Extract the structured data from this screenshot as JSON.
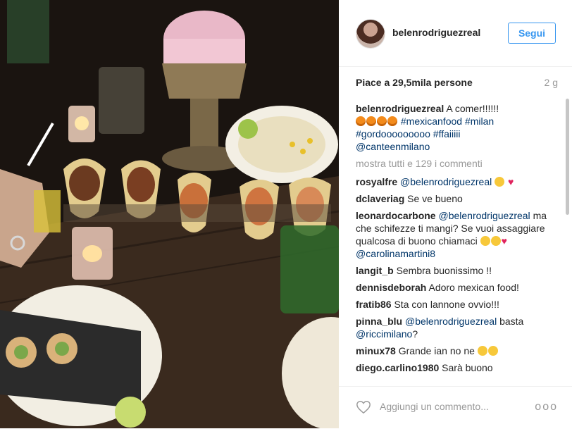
{
  "post": {
    "username": "belenrodriguezreal",
    "follow_label": "Segui",
    "likes": "Piace a 29,5mila persone",
    "time": "2 g"
  },
  "caption": {
    "user": "belenrodriguezreal",
    "text": "A comer!!!!!!",
    "hashtags": [
      "#mexicanfood",
      "#milan",
      "#gordooooooooo",
      "#ffaiiiii"
    ],
    "mention": "@canteenmilano"
  },
  "more_comments": "mostra tutti e 129 i commenti",
  "comments": [
    {
      "user": "rosyalfre",
      "text": "@belenrodriguezreal"
    },
    {
      "user": "dclaveriag",
      "text": "Se ve bueno"
    },
    {
      "user": "leonardocarbone",
      "text_a": "@belenrodriguezreal",
      "text_b": "ma che schifezze ti mangi? Se vuoi assaggiare qualcosa di buono chiamaci",
      "text_c": "@carolinamartini8"
    },
    {
      "user": "langit_b",
      "text": "Sembra buonissimo !!"
    },
    {
      "user": "dennisdeborah",
      "text": "Adoro mexican food!"
    },
    {
      "user": "fratib86",
      "text": "Sta con lannone ovvio!!!"
    },
    {
      "user": "pinna_blu",
      "text_a": "@belenrodriguezreal",
      "text_b": "basta",
      "text_c": "@riccimilano",
      "text_d": "?"
    },
    {
      "user": "minux78",
      "text": "Grande ian no ne"
    },
    {
      "user": "diego.carlino1980",
      "text": "Sarà buono"
    }
  ],
  "footer": {
    "add_comment_placeholder": "Aggiungi un commento...",
    "more_label": "ooo"
  },
  "icons": {
    "like": "heart-outline-icon",
    "options": "more-options-icon"
  },
  "colors": {
    "link": "#003569",
    "follow_blue": "#3897f0",
    "muted": "#999999"
  }
}
